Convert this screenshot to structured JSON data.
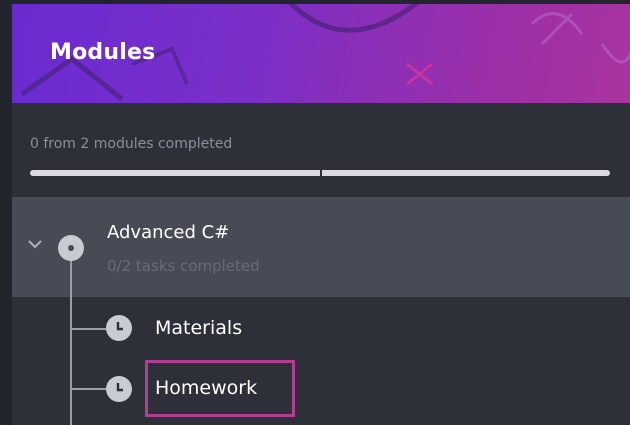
{
  "header": {
    "title": "Modules"
  },
  "overall_progress": {
    "text": "0 from 2 modules completed",
    "completed": 0,
    "total": 2
  },
  "module": {
    "title": "Advanced C#",
    "subtitle": "0/2 tasks completed",
    "expanded": true,
    "tasks": [
      {
        "label": "Materials"
      },
      {
        "label": "Homework",
        "highlighted": true
      }
    ]
  },
  "colors": {
    "header_gradient_start": "#6a2bd1",
    "header_gradient_end": "#a8349f",
    "background": "#2d3039",
    "module_row": "#474b56",
    "highlight": "#b13e93"
  }
}
